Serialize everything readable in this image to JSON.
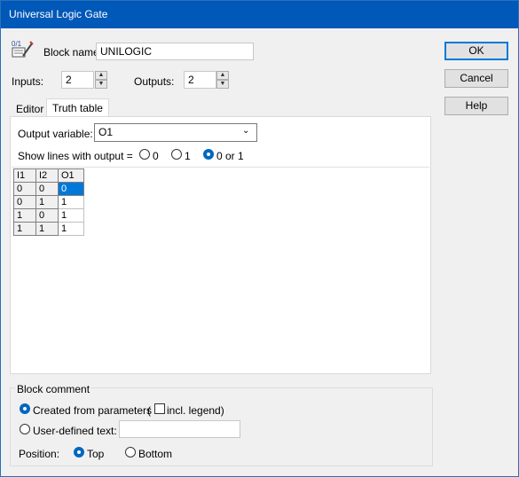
{
  "window": {
    "title": "Universal Logic Gate"
  },
  "block_name": {
    "label": "Block name:",
    "value": "UNILOGIC",
    "icon": "logic-gate-icon"
  },
  "inputs": {
    "label": "Inputs:",
    "value": "2"
  },
  "outputs": {
    "label": "Outputs:",
    "value": "2"
  },
  "buttons": {
    "ok": "OK",
    "cancel": "Cancel",
    "help": "Help"
  },
  "tabs": [
    {
      "label": "Editor"
    },
    {
      "label": "Truth table"
    }
  ],
  "output_variable": {
    "label": "Output variable:",
    "value": "O1"
  },
  "show_lines": {
    "label": "Show lines with output =",
    "options": [
      {
        "label": "0",
        "selected": false
      },
      {
        "label": "1",
        "selected": false
      },
      {
        "label": "0 or 1",
        "selected": true
      }
    ]
  },
  "truth_table": {
    "headers": [
      "I1",
      "I2",
      "O1"
    ],
    "rows": [
      [
        "0",
        "0",
        "0"
      ],
      [
        "0",
        "1",
        "1"
      ],
      [
        "1",
        "0",
        "1"
      ],
      [
        "1",
        "1",
        "1"
      ]
    ]
  },
  "block_comment": {
    "title": "Block comment",
    "created_from_parameters": "Created from parameters",
    "paren_open": "(",
    "incl_legend": "incl. legend)",
    "user_defined": "User-defined text:",
    "position_label": "Position:",
    "top": "Top",
    "bottom": "Bottom"
  },
  "colors": {
    "titlebar": "#0058b8",
    "selection": "#0078d7"
  }
}
